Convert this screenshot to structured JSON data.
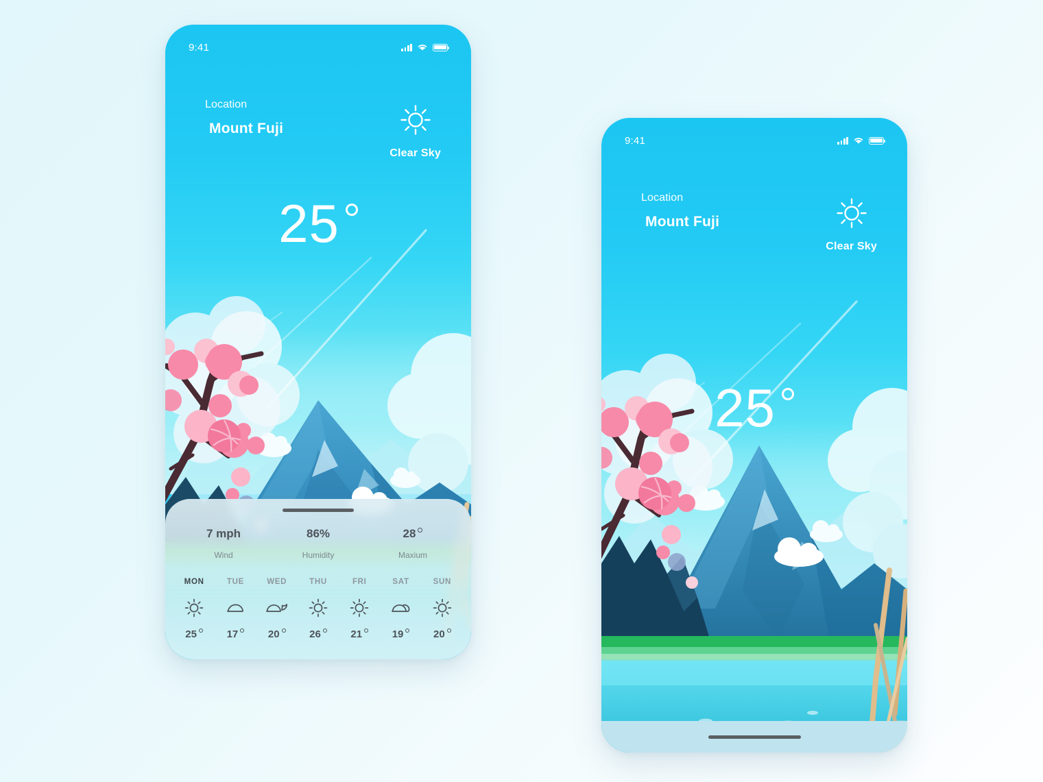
{
  "theme": {
    "page_bg_from": "#e2f7fb",
    "page_bg_to": "#fdfeff",
    "sky_top": "#1cc6f2",
    "sky_bottom": "#9eeff7",
    "accent": "#21c9f5",
    "text_dark": "#4c5359",
    "text_muted": "#7c878e",
    "blossom_pink": "#f78aa8",
    "mountain_blue": "#2f8fc0"
  },
  "phones": [
    {
      "id": "phone-1",
      "name": "weather-detail-screen",
      "status_bar": {
        "time": "9:41",
        "signal_icon": "signal-bars-icon",
        "wifi_icon": "wifi-icon",
        "battery_icon": "battery-icon"
      },
      "header": {
        "location_label": "Location",
        "location_name": "Mount Fuji",
        "condition_icon": "sun-icon",
        "condition_label": "Clear Sky"
      },
      "temperature": {
        "value": "25",
        "unit_icon": "degree-circle-icon"
      },
      "sheet": {
        "handle_icon": "drag-handle-icon",
        "stats": [
          {
            "value": "7 mph",
            "label": "Wind",
            "has_degree": false
          },
          {
            "value": "86%",
            "label": "Humidity",
            "has_degree": false
          },
          {
            "value": "28",
            "label": "Maxium",
            "has_degree": true
          }
        ],
        "forecast": [
          {
            "day": "MON",
            "icon": "sun-icon",
            "temp": "25",
            "active": true
          },
          {
            "day": "TUE",
            "icon": "cloud-icon",
            "temp": "17",
            "active": false
          },
          {
            "day": "WED",
            "icon": "cloud-moon-icon",
            "temp": "20",
            "active": false
          },
          {
            "day": "THU",
            "icon": "sun-icon",
            "temp": "26",
            "active": false
          },
          {
            "day": "FRI",
            "icon": "sun-icon",
            "temp": "21",
            "active": false
          },
          {
            "day": "SAT",
            "icon": "cloud-icon",
            "temp": "19",
            "active": false
          },
          {
            "day": "SUN",
            "icon": "sun-icon",
            "temp": "20",
            "active": false
          }
        ]
      }
    },
    {
      "id": "phone-2",
      "name": "weather-fullscene-screen",
      "status_bar": {
        "time": "9:41",
        "signal_icon": "signal-bars-icon",
        "wifi_icon": "wifi-icon",
        "battery_icon": "battery-icon"
      },
      "header": {
        "location_label": "Location",
        "location_name": "Mount Fuji",
        "condition_icon": "sun-icon",
        "condition_label": "Clear Sky"
      },
      "temperature": {
        "value": "25",
        "unit_icon": "degree-circle-icon"
      },
      "home_indicator_icon": "home-indicator-icon"
    }
  ]
}
